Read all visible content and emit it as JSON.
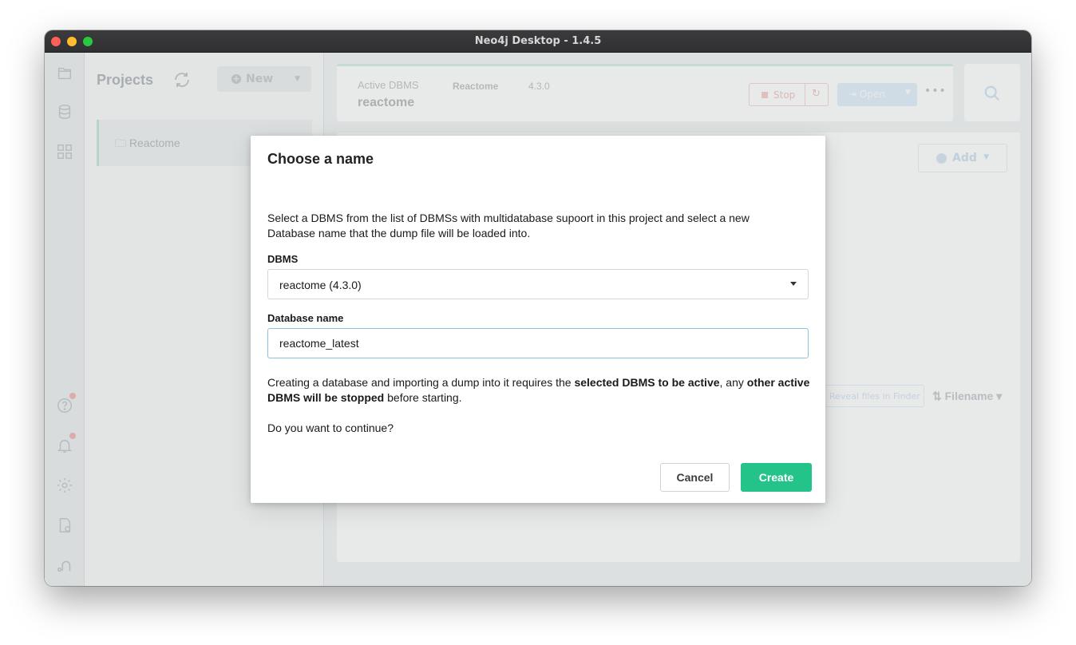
{
  "window": {
    "title": "Neo4j Desktop - 1.4.5"
  },
  "rail": {
    "top_icons": [
      "projects-icon",
      "database-icon",
      "apps-grid-icon"
    ],
    "bottom_icons": [
      "help-icon",
      "bell-icon",
      "gear-icon",
      "license-icon",
      "neo4j-logo-icon"
    ]
  },
  "projects": {
    "title": "Projects",
    "new_label": "New",
    "items": [
      {
        "label": "Reactome"
      }
    ]
  },
  "active_dbms": {
    "label": "Active DBMS",
    "project": "Reactome",
    "version": "4.3.0",
    "name": "reactome",
    "stop_label": "Stop",
    "open_label": "Open"
  },
  "content": {
    "add_label": "Add",
    "reveal_label": "Reveal files in Finder",
    "sort_label": "Filename"
  },
  "modal": {
    "title": "Choose a name",
    "description": "Select a DBMS from the list of DBMSs with multidatabase supoort in this project and select a new Database name that the dump file will be loaded into.",
    "dbms_label": "DBMS",
    "dbms_value": "reactome (4.3.0)",
    "name_label": "Database name",
    "name_value": "reactome_latest",
    "warning_1": "Creating a database and importing a dump into it requires the ",
    "warning_bold_1": "selected DBMS to be active",
    "warning_2": ", any ",
    "warning_bold_2": "other active DBMS will be stopped",
    "warning_3": " before starting.",
    "question": "Do you want to continue?",
    "cancel_label": "Cancel",
    "create_label": "Create"
  },
  "colors": {
    "accent": "#23c38a",
    "input_focus": "#8fc3dc"
  }
}
